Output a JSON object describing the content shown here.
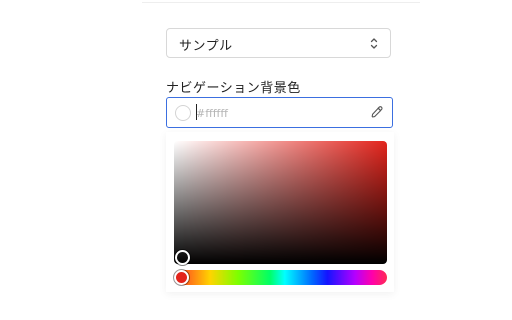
{
  "select": {
    "value": "サンプル",
    "icon": "chevron-up-down-icon"
  },
  "nav_bg": {
    "label": "ナビゲーション背景色",
    "placeholder": "#ffffff",
    "value": "",
    "swatch_color": "#ffffff",
    "eyedropper_icon": "eyedropper-icon"
  },
  "picker": {
    "hue_color": "#e3241c",
    "saturation": 0,
    "brightness": 0,
    "hue_degrees": 0
  }
}
